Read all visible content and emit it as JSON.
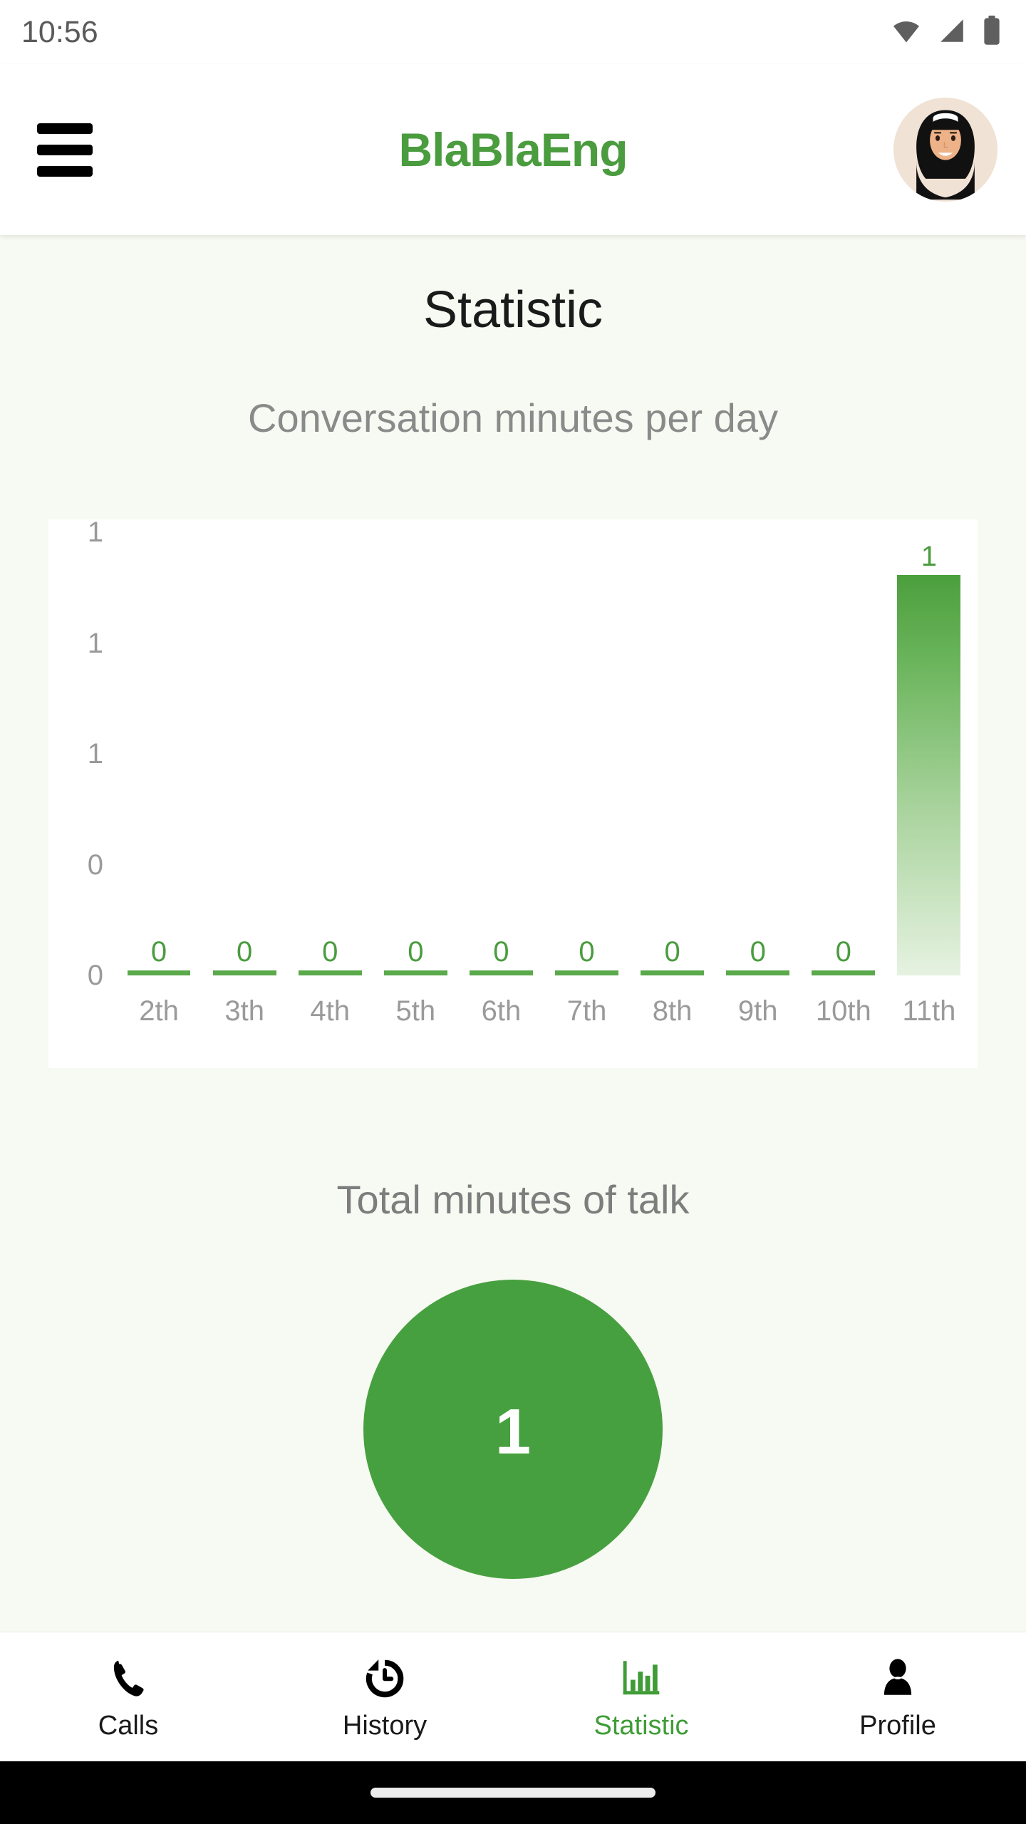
{
  "status_bar": {
    "time": "10:56",
    "icons": [
      "wifi-icon",
      "cellular-signal-icon",
      "battery-icon"
    ]
  },
  "app_bar": {
    "menu_icon": "hamburger-menu-icon",
    "title": "BlaBlaEng",
    "title_color": "#4a9c3f",
    "avatar_alt": "user-avatar"
  },
  "page": {
    "title": "Statistic",
    "background_color": "#f7faf2"
  },
  "chart_section": {
    "heading": "Conversation minutes per day",
    "card_background": "#ffffff"
  },
  "total_section": {
    "heading": "Total minutes of talk",
    "value": "1",
    "circle_color": "#47a03f",
    "value_color": "#ffffff"
  },
  "bottom_nav": {
    "items": [
      {
        "label": "Calls",
        "icon": "phone-icon",
        "active": false
      },
      {
        "label": "History",
        "icon": "history-icon",
        "active": false
      },
      {
        "label": "Statistic",
        "icon": "bar-chart-icon",
        "active": true
      },
      {
        "label": "Profile",
        "icon": "person-icon",
        "active": false
      }
    ],
    "active_color": "#3f9c36",
    "inactive_color": "#1a1a1a"
  },
  "system_nav": {
    "gesture_pill": "home-gesture-pill"
  },
  "chart_data": {
    "type": "bar",
    "title": "Conversation minutes per day",
    "xlabel": "",
    "ylabel": "",
    "categories": [
      "2th",
      "3th",
      "4th",
      "5th",
      "6th",
      "7th",
      "8th",
      "9th",
      "10th",
      "11th"
    ],
    "values": [
      0,
      0,
      0,
      0,
      0,
      0,
      0,
      0,
      0,
      1
    ],
    "data_labels": [
      "0",
      "0",
      "0",
      "0",
      "0",
      "0",
      "0",
      "0",
      "0",
      "1"
    ],
    "y_ticks": [
      "1",
      "1",
      "1",
      "0",
      "0"
    ],
    "y_tick_values": [
      1.0,
      0.8,
      0.6,
      0.4,
      0.2
    ],
    "ylim": [
      0,
      1
    ],
    "grid": false,
    "legend": false,
    "bar_color": "#4c9f3d",
    "bar_gradient": [
      "#4c9f3d",
      "#e6f2e1"
    ],
    "label_color": "#4a9c3f",
    "tick_color": "#9a9a9a"
  }
}
